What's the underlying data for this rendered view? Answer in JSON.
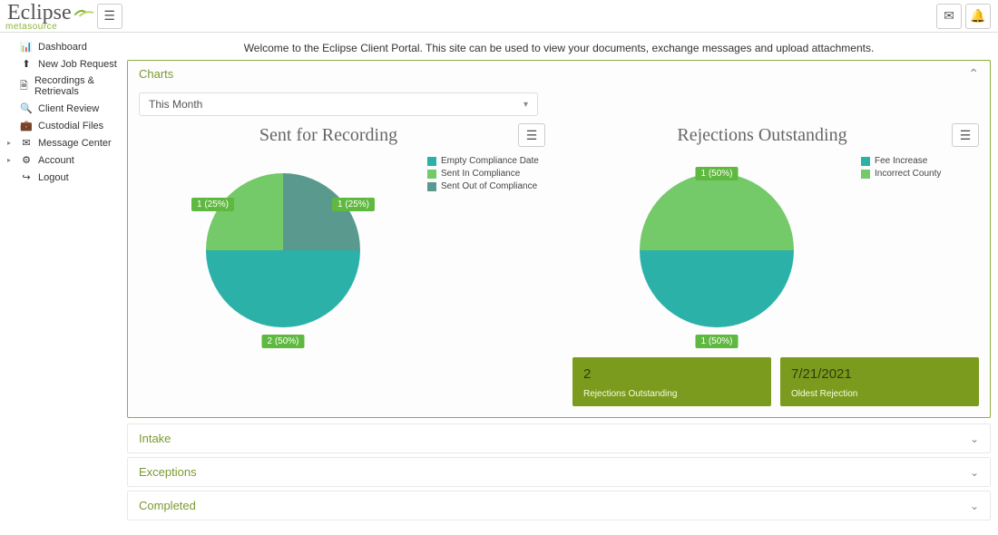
{
  "header": {
    "logo_main": "Eclipse",
    "logo_sub": "metasource"
  },
  "welcome_text": "Welcome to the Eclipse Client Portal. This site can be used to view your documents, exchange messages and upload attachments.",
  "sidebar": {
    "items": [
      {
        "label": "Dashboard",
        "icon": "bar-chart"
      },
      {
        "label": "New Job Request",
        "icon": "upload"
      },
      {
        "label": "Recordings & Retrievals",
        "icon": "document"
      },
      {
        "label": "Client Review",
        "icon": "search"
      },
      {
        "label": "Custodial Files",
        "icon": "briefcase"
      },
      {
        "label": "Message Center",
        "icon": "envelope",
        "caret": true
      },
      {
        "label": "Account",
        "icon": "gear",
        "caret": true
      },
      {
        "label": "Logout",
        "icon": "logout"
      }
    ]
  },
  "charts_panel": {
    "title": "Charts",
    "filter_label": "This Month"
  },
  "chart_data": [
    {
      "type": "pie",
      "title": "Sent for Recording",
      "series": [
        {
          "name": "Empty Compliance Date",
          "value": 2,
          "pct": 50,
          "label": "2 (50%)",
          "color": "#2cb1a9"
        },
        {
          "name": "Sent In Compliance",
          "value": 1,
          "pct": 25,
          "label": "1 (25%)",
          "color": "#74c969"
        },
        {
          "name": "Sent Out of Compliance",
          "value": 1,
          "pct": 25,
          "label": "1 (25%)",
          "color": "#5a9a8e"
        }
      ]
    },
    {
      "type": "pie",
      "title": "Rejections Outstanding",
      "series": [
        {
          "name": "Fee Increase",
          "value": 1,
          "pct": 50,
          "label": "1 (50%)",
          "color": "#2cb1a9"
        },
        {
          "name": "Incorrect County",
          "value": 1,
          "pct": 50,
          "label": "1 (50%)",
          "color": "#74c969"
        }
      ]
    }
  ],
  "stats": [
    {
      "value": "2",
      "label": "Rejections Outstanding"
    },
    {
      "value": "7/21/2021",
      "label": "Oldest Rejection"
    }
  ],
  "accordions": [
    {
      "title": "Intake"
    },
    {
      "title": "Exceptions"
    },
    {
      "title": "Completed"
    }
  ]
}
